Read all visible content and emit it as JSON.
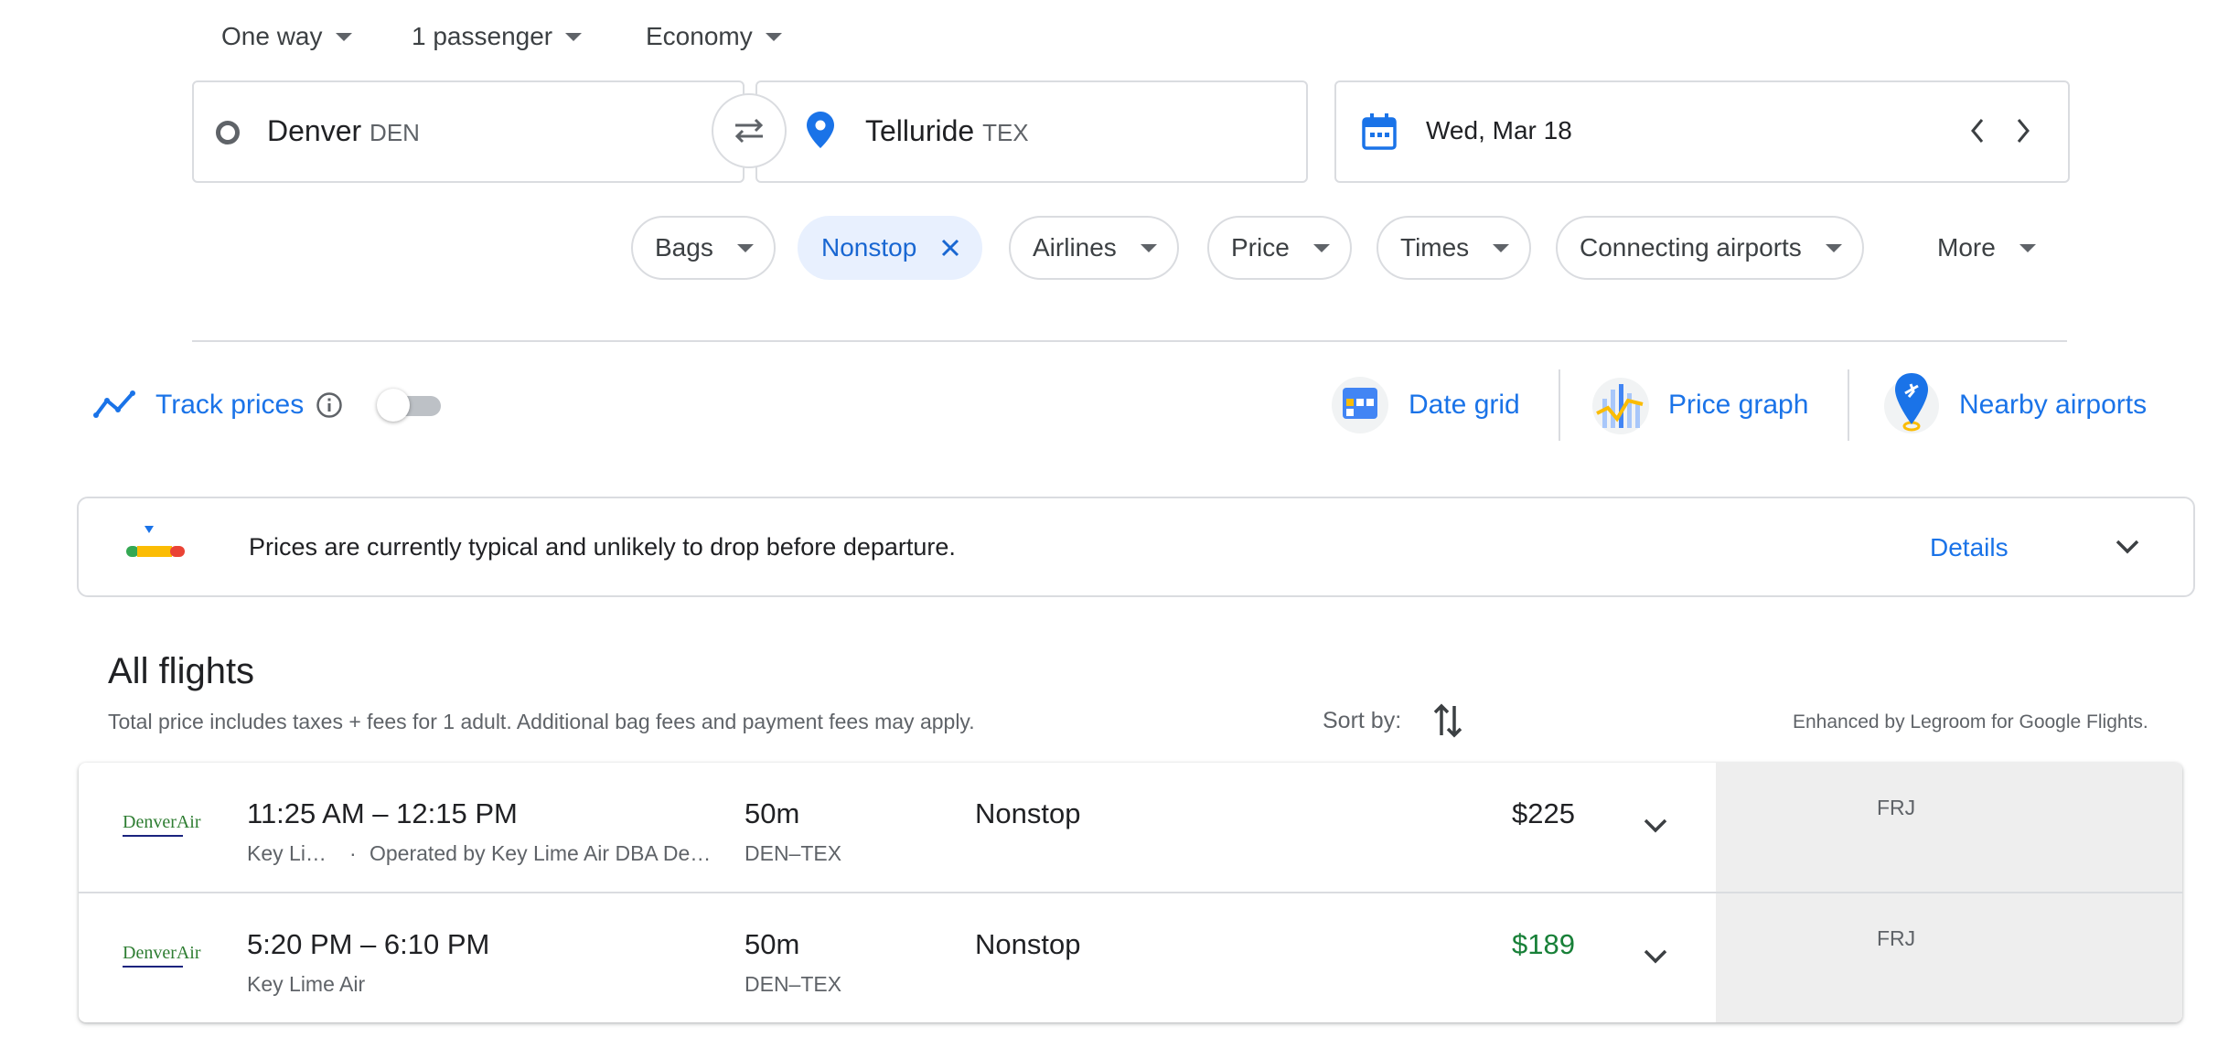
{
  "search": {
    "trip_type": "One way",
    "passengers": "1 passenger",
    "cabin": "Economy",
    "origin_city": "Denver",
    "origin_code": "DEN",
    "dest_city": "Telluride",
    "dest_code": "TEX",
    "date": "Wed, Mar 18"
  },
  "filters": [
    {
      "label": "Bags",
      "active": false
    },
    {
      "label": "Nonstop",
      "active": true
    },
    {
      "label": "Airlines",
      "active": false
    },
    {
      "label": "Price",
      "active": false
    },
    {
      "label": "Times",
      "active": false
    },
    {
      "label": "Connecting airports",
      "active": false
    },
    {
      "label": "More",
      "active": false
    }
  ],
  "tools": {
    "track_prices": "Track prices",
    "track_enabled": false,
    "date_grid": "Date grid",
    "price_graph": "Price graph",
    "nearby_airports": "Nearby airports"
  },
  "insight": {
    "text": "Prices are currently typical and unlikely to drop before departure.",
    "details": "Details"
  },
  "results": {
    "title": "All flights",
    "note": "Total price includes taxes + fees for 1 adult. Additional bag fees and payment fees may apply.",
    "sort_label": "Sort by:",
    "enhanced": "Enhanced by Legroom for Google Flights."
  },
  "flights": [
    {
      "logo_text": "DenverAir",
      "times": "11:25 AM – 12:15 PM",
      "airline": "Key Li…",
      "operated": "Operated by Key Lime Air DBA De…",
      "duration": "50m",
      "route": "DEN–TEX",
      "stops": "Nonstop",
      "price": "$225",
      "price_color": "#202124",
      "aircraft": "FRJ"
    },
    {
      "logo_text": "DenverAir",
      "times": "5:20 PM – 6:10 PM",
      "airline": "Key Lime Air",
      "operated": "",
      "duration": "50m",
      "route": "DEN–TEX",
      "stops": "Nonstop",
      "price": "$189",
      "price_color": "#188038",
      "aircraft": "FRJ"
    }
  ],
  "colors": {
    "accent": "#1a73e8",
    "cheap_price": "#188038",
    "chip_active_bg": "#e8f0fe"
  }
}
